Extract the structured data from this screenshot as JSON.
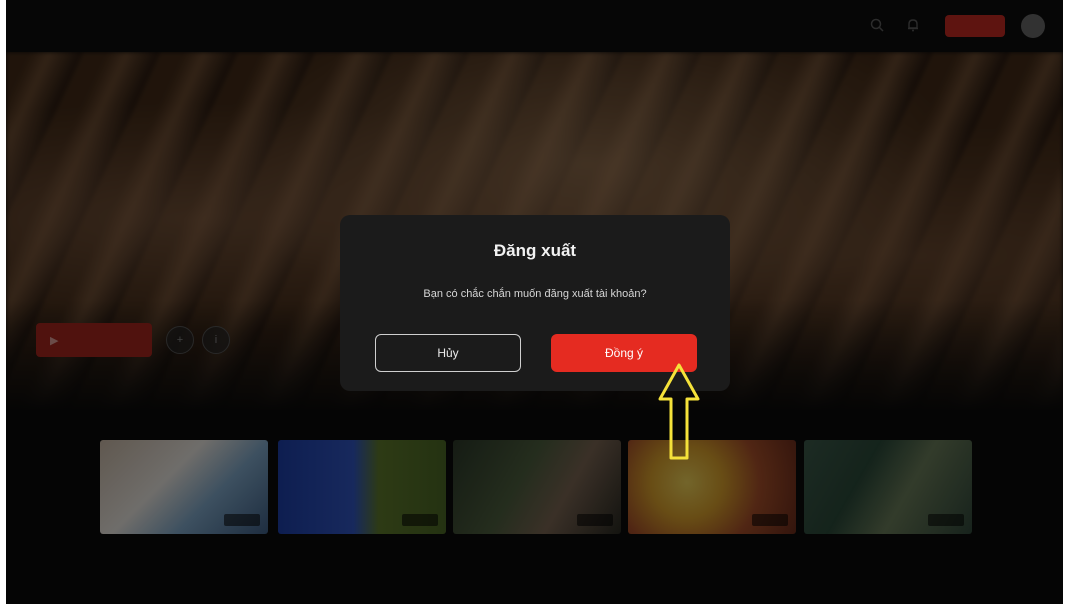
{
  "nav": {
    "logo": "",
    "items": [
      "",
      "",
      "",
      "",
      ""
    ],
    "center_text": "",
    "vip_label": ""
  },
  "hero": {
    "play_label": "",
    "meta": ""
  },
  "rows": {
    "row1_title": "",
    "row2_title": "",
    "cards": [
      {
        "caption": ""
      },
      {
        "caption": ""
      },
      {
        "caption": ""
      },
      {
        "caption": ""
      },
      {
        "caption": ""
      }
    ]
  },
  "dialog": {
    "title": "Đăng xuất",
    "message": "Bạn có chắc chắn muốn đăng xuất tài khoản?",
    "cancel_label": "Hủy",
    "confirm_label": "Đồng ý"
  },
  "colors": {
    "accent": "#e52b21",
    "dialog_bg": "#1b1b1b",
    "annotation": "#f5e23a"
  },
  "icons": {
    "search": "search-icon",
    "notification": "bell-icon",
    "annotation": "arrow-up-icon"
  }
}
